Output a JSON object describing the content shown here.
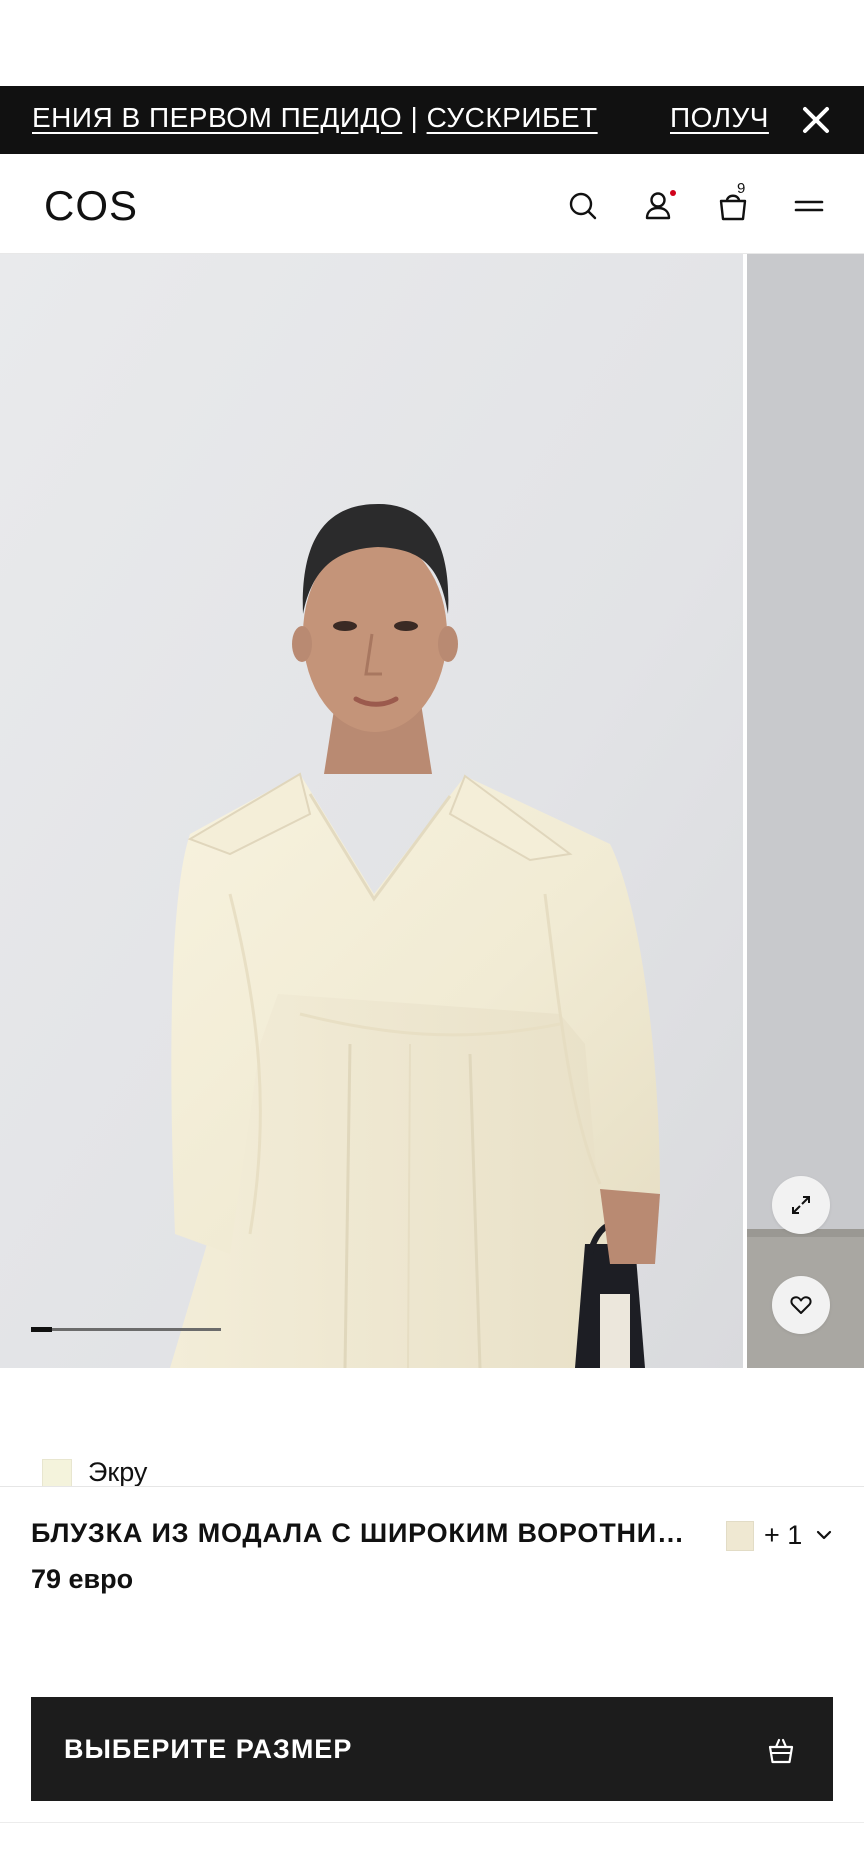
{
  "promo": {
    "text_primary": "ЕНИЯ В ПЕРВОМ ПЕДИДО",
    "separator": " | ",
    "text_secondary": "СУСКРИБЕТ",
    "text_next": "ПОЛУЧ"
  },
  "header": {
    "logo": "COS",
    "bag_count": "9"
  },
  "gallery": {
    "progress": 0.11
  },
  "product": {
    "color_name": "Экру",
    "title": "БЛУЗКА ИЗ МОДАЛА С ШИРОКИМ ВОРОТНИКОМ",
    "price": "79 евро",
    "variant_count": "+ 1"
  },
  "actions": {
    "size_button_label": "ВЫБЕРИТЕ РАЗМЕР"
  },
  "colors": {
    "promo_bg": "#111111",
    "button_bg": "#1c1c1c",
    "account_dot": "#d0021b",
    "swatch_ecru": "#f4f3dc"
  },
  "icons": [
    "close-icon",
    "search-icon",
    "user-icon",
    "bag-icon",
    "menu-icon",
    "expand-icon",
    "heart-icon",
    "chevron-down-icon"
  ]
}
